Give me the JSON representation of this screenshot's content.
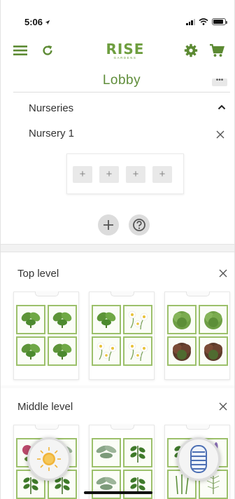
{
  "status_bar": {
    "time": "5:06"
  },
  "header": {
    "logo_main": "RISE",
    "logo_sub": "GARDENS",
    "title": "Lobby",
    "more_label": "•••"
  },
  "nurseries": {
    "section_label": "Nurseries",
    "items": [
      {
        "label": "Nursery 1",
        "slots": [
          "+",
          "+",
          "+",
          "+"
        ]
      }
    ]
  },
  "levels": [
    {
      "label": "Top level",
      "towers": [
        {
          "pods": [
            "basil",
            "basil",
            "basil",
            "basil"
          ]
        },
        {
          "pods": [
            "basil",
            "chamomile",
            "chamomile",
            "chamomile"
          ]
        },
        {
          "pods": [
            "lettuce-green",
            "lettuce-green",
            "lettuce-red",
            "lettuce-red"
          ]
        }
      ]
    },
    {
      "label": "Middle level",
      "towers": [
        {
          "pods": [
            "flower",
            "sage",
            "herb",
            "herb"
          ]
        },
        {
          "pods": [
            "sage",
            "herb",
            "sage",
            "herb"
          ]
        },
        {
          "pods": [
            "herb",
            "lavender",
            "chive",
            "dill"
          ]
        }
      ]
    }
  ],
  "colors": {
    "accent": "#6e9e3f",
    "pod_border": "#9cc06b"
  },
  "icons": [
    "menu-icon",
    "refresh-icon",
    "settings-icon",
    "cart-icon",
    "chevron-up-icon",
    "close-icon",
    "add-icon",
    "help-icon",
    "sun-icon",
    "tower-icon"
  ]
}
